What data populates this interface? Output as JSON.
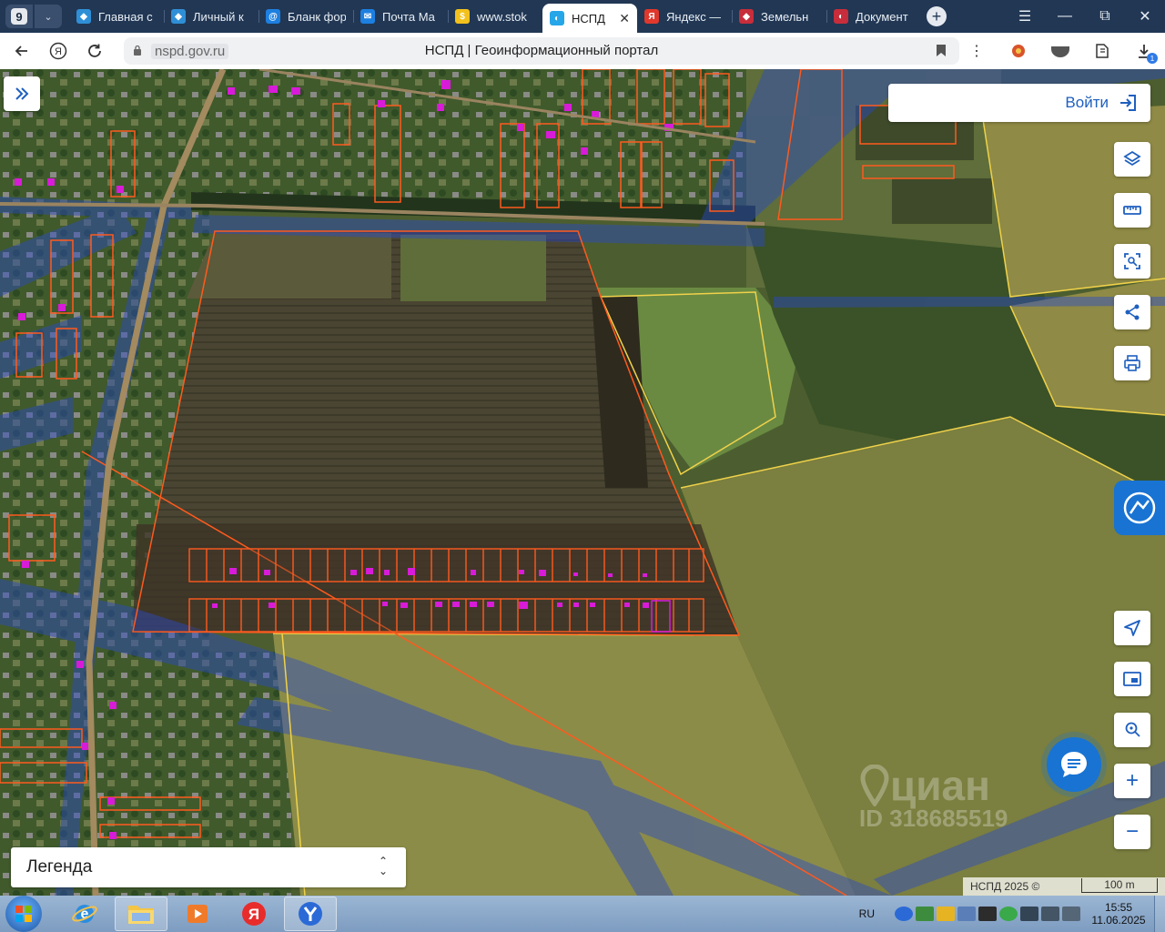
{
  "browser": {
    "tab_count": "9",
    "tabs": [
      {
        "label": "Главная с",
        "color": "#2f8fd6",
        "glyph": "◆"
      },
      {
        "label": "Личный к",
        "color": "#2f8fd6",
        "glyph": "◆"
      },
      {
        "label": "Бланк фор",
        "color": "#1d7fe0",
        "glyph": "@"
      },
      {
        "label": "Почта Ма",
        "color": "#1d7fe0",
        "glyph": "✉"
      },
      {
        "label": "www.stok",
        "color": "#f3c11b",
        "glyph": "$"
      },
      {
        "label": "НСПД",
        "color": "#25a6e8",
        "glyph": "◐",
        "active": true
      },
      {
        "label": "Яндекс —",
        "color": "#e0382b",
        "glyph": "Я"
      },
      {
        "label": "Земельн",
        "color": "#c72d3a",
        "glyph": "◆"
      },
      {
        "label": "Документ",
        "color": "#c72d3a",
        "glyph": "◐"
      }
    ],
    "close_glyph": "✕",
    "new_tab_glyph": "+",
    "address": {
      "domain": "nspd.gov.ru",
      "page_title": "НСПД | Геоинформационный портал"
    },
    "downloads_badge": "1",
    "window_controls": [
      "☰",
      "—",
      "⧉",
      "✕"
    ]
  },
  "map": {
    "login_label": "Войти",
    "legend_label": "Легенда",
    "legend_toggle": [
      "⌃",
      "⌄"
    ],
    "right_tools": [
      "layers-icon",
      "ruler-icon",
      "select-area-icon",
      "share-icon",
      "print-icon"
    ],
    "nav_tools": [
      "locate-icon",
      "basemap-icon",
      "search-point-icon"
    ],
    "zoom_in": "+",
    "zoom_out": "−",
    "watermark": {
      "brand": "циан",
      "id": "ID 318685519"
    },
    "attribution": "НСПД 2025 ©",
    "scale_label": "100 m"
  },
  "taskbar": {
    "language": "RU",
    "time": "15:55",
    "date": "11.06.2025"
  },
  "colors": {
    "parcel_orange": "#ff5a1e",
    "parcel_yellow": "#f0d24a",
    "building_magenta": "#d81bd8",
    "zone_blue": "#2a49c8",
    "accent_blue": "#1873d3"
  }
}
